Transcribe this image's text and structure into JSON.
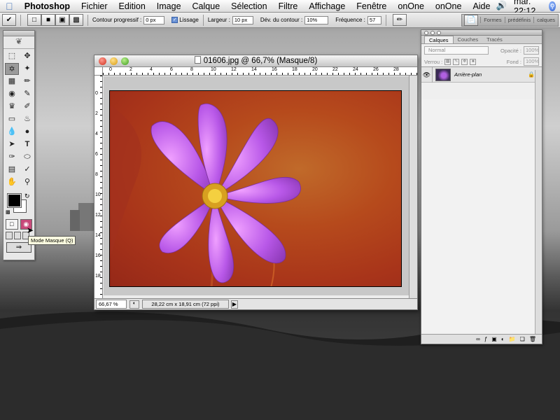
{
  "menubar": {
    "app": "Photoshop",
    "items": [
      "Fichier",
      "Edition",
      "Image",
      "Calque",
      "Sélection",
      "Filtre",
      "Affichage",
      "Fenêtre",
      "onOne",
      "onOne",
      "Aide"
    ],
    "clock": "mar. 22:12"
  },
  "options": {
    "contour_label": "Contour progressif :",
    "contour_value": "0 px",
    "lissage_label": "Lissage",
    "largeur_label": "Largeur :",
    "largeur_value": "10 px",
    "dev_label": "Dév. du contour :",
    "dev_value": "10%",
    "freq_label": "Fréquence :",
    "freq_value": "57",
    "palette_well": [
      "Formes",
      "prédéfinis",
      "calques"
    ]
  },
  "toolbox": {
    "tooltip": "Mode Masque (Q)"
  },
  "document": {
    "title": "01606.jpg @ 66,7% (Masque/8)",
    "zoom": "66,67 %",
    "info": "28,22 cm x 18,91 cm (72 ppi)",
    "ruler_h": [
      "0",
      "2",
      "4",
      "6",
      "8",
      "10",
      "12",
      "14",
      "16",
      "18",
      "20",
      "22",
      "24",
      "26",
      "28"
    ],
    "ruler_v": [
      "0",
      "2",
      "4",
      "6",
      "8",
      "10",
      "12",
      "14",
      "16",
      "18"
    ]
  },
  "layers": {
    "tabs": [
      "Calques",
      "Couches",
      "Tracés"
    ],
    "blend_mode": "Normal",
    "opacity_label": "Opacité :",
    "opacity_value": "100%",
    "lock_label": "Verrou :",
    "fill_label": "Fond :",
    "fill_value": "100%",
    "layer_name": "Arrière-plan"
  }
}
